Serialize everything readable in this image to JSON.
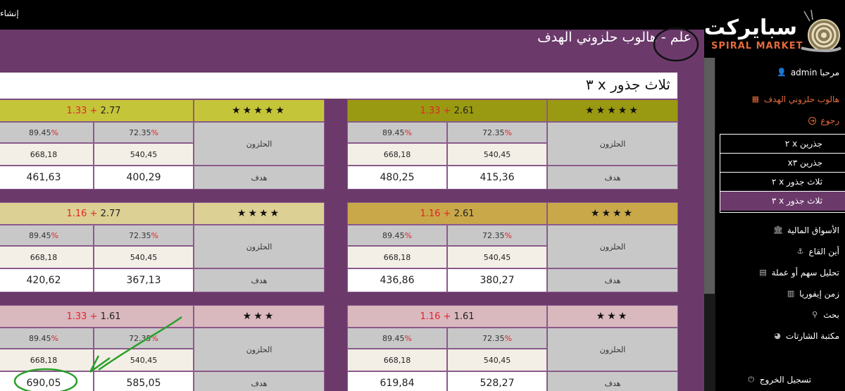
{
  "topbar": {
    "create_label": "إنشاء"
  },
  "logo": {
    "arabic": "سبايركت",
    "english": "SPIRAL MARKET"
  },
  "page_title": "علم - هالوب حلزوني الهدف",
  "section_title": "ثلاث جذور x ٣",
  "sidebar": {
    "welcome": "مرحبا admin",
    "spiral_target": "هالوب حلزوني الهدف",
    "back": "رجوع",
    "submenu": [
      "جذرين x ٢",
      "جذرين x٣",
      "ثلاث جذور x ٢",
      "ثلاث جذور x ٣"
    ],
    "markets": "الأسواق المالية",
    "where_bottom": "أين القاع",
    "analysis": "تحليل سهم أو عملة",
    "euphoria": "زمن إيفوريا",
    "search": "بحث",
    "library": "مكتبة الشارتات",
    "logout": "تسجيل الخروج"
  },
  "labels": {
    "spiral": "الحلزون",
    "target": "هدف"
  },
  "blocks": [
    {
      "stars": "★★★★★",
      "hdr_black": "2.61",
      "hdr_red": "1.33",
      "p1": "72.35",
      "p2": "89.45",
      "r2a": "540,45",
      "r2b": "668,18",
      "t1": "415,36",
      "t2": "480,25"
    },
    {
      "stars": "★★★★★",
      "hdr_black": "2.77",
      "hdr_red": "1.33",
      "p1": "72.35",
      "p2": "89.45",
      "r2a": "540,45",
      "r2b": "668,18",
      "t1": "400,29",
      "t2": "461,63"
    },
    {
      "stars": "★★★★",
      "hdr_black": "2.61",
      "hdr_red": "1.16",
      "p1": "72.35",
      "p2": "89.45",
      "r2a": "540,45",
      "r2b": "668,18",
      "t1": "380,27",
      "t2": "436,86"
    },
    {
      "stars": "★★★★",
      "hdr_black": "2.77",
      "hdr_red": "1.16",
      "p1": "72.35",
      "p2": "89.45",
      "r2a": "540,45",
      "r2b": "668,18",
      "t1": "367,13",
      "t2": "420,62"
    },
    {
      "stars": "★★★",
      "hdr_black": "1.61",
      "hdr_red": "1.16",
      "p1": "72.35",
      "p2": "89.45",
      "r2a": "540,45",
      "r2b": "668,18",
      "t1": "528,27",
      "t2": "619,84"
    },
    {
      "stars": "★★★",
      "hdr_black": "1.61",
      "hdr_red": "1.33",
      "p1": "72.35",
      "p2": "89.45",
      "r2a": "540,45",
      "r2b": "668,18",
      "t1": "585,05",
      "t2": "690,05"
    }
  ],
  "colors": {
    "row1_header": "#9a9a12",
    "row1_header_right": "#c5c53a",
    "row2_header": "#c9a84a",
    "row2_header_right": "#ddd094",
    "row3_header": "#d9b8be",
    "annotation": "#2aa02a"
  }
}
